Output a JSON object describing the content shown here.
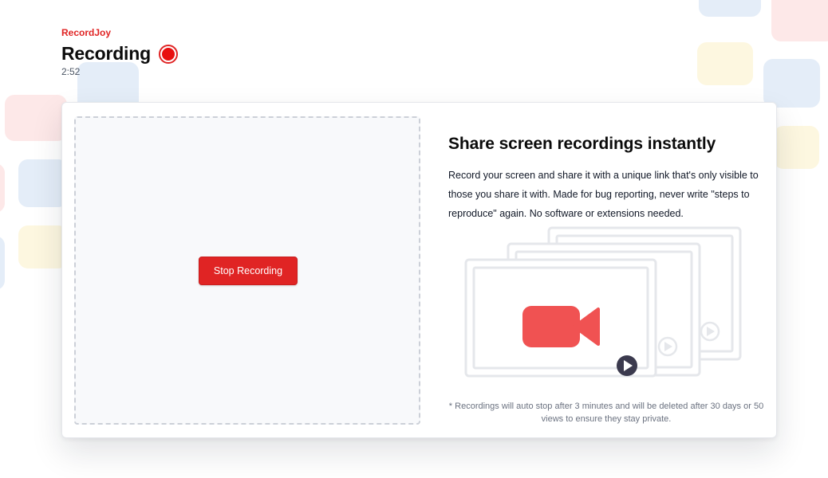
{
  "app": {
    "brand": "RecordJoy"
  },
  "header": {
    "title": "Recording",
    "timer": "2:52"
  },
  "recorder": {
    "stop_label": "Stop Recording"
  },
  "info": {
    "headline": "Share screen recordings instantly",
    "description": "Record your screen and share it with a unique link that's only visible to those you share it with. Made for bug reporting, never write \"steps to reproduce\" again. No software or extensions needed.",
    "footnote": "* Recordings will auto stop after 3 minutes and will be deleted after 30 days or 50 views to ensure they stay private."
  },
  "icons": {
    "recording_indicator": "red-record-dot-icon",
    "illustration": "video-camera-icon",
    "play": "play-icon"
  },
  "colors": {
    "accent": "#e02424",
    "camera": "#f05252",
    "play_dark": "#3b3a4e",
    "frame": "#e5e7eb"
  }
}
